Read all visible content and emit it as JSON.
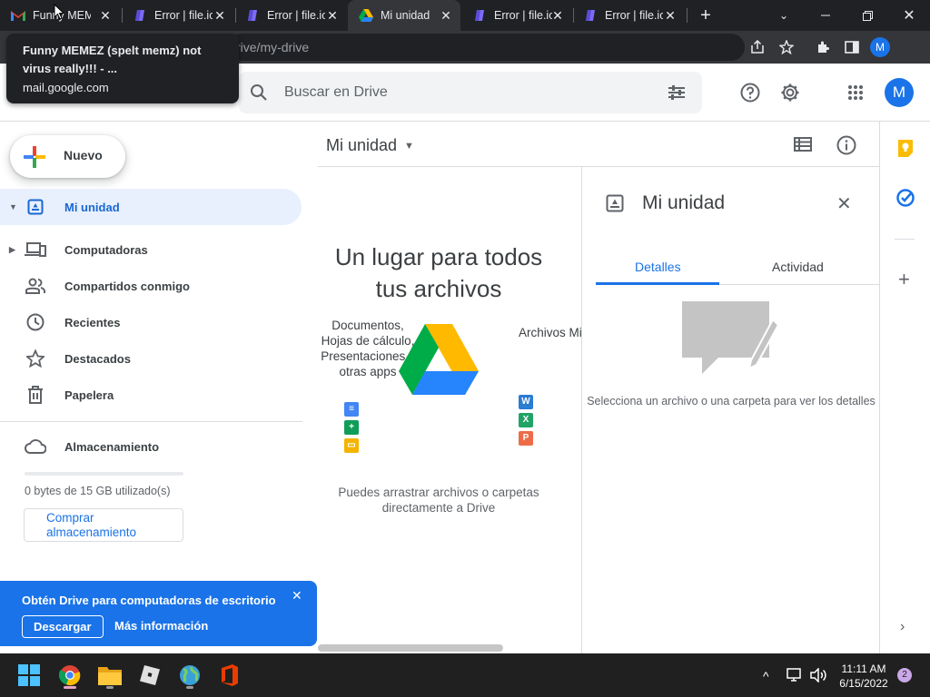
{
  "browser": {
    "tabs": [
      {
        "title": "Funny MEMEZ",
        "icon": "gmail-icon",
        "active": false
      },
      {
        "title": "Error | file.io",
        "icon": "fileio-icon",
        "active": false
      },
      {
        "title": "Error | file.io",
        "icon": "fileio-icon",
        "active": false
      },
      {
        "title": "Mi unidad",
        "icon": "drive-icon",
        "active": true
      },
      {
        "title": "Error | file.io",
        "icon": "fileio-icon",
        "active": false
      },
      {
        "title": "Error | file.io",
        "icon": "fileio-icon",
        "active": false
      }
    ],
    "address": "rive/my-drive",
    "profile_initial": "M"
  },
  "tooltip": {
    "title": "Funny MEMEZ (spelt memz) not virus really!!! - ...",
    "domain": "mail.google.com"
  },
  "header": {
    "search_placeholder": "Buscar en Drive",
    "avatar_initial": "M"
  },
  "sidebar": {
    "new_label": "Nuevo",
    "items": [
      {
        "label": "Mi unidad",
        "icon": "drive-icon"
      },
      {
        "label": "Computadoras",
        "icon": "computer-icon"
      },
      {
        "label": "Compartidos conmigo",
        "icon": "people-icon"
      },
      {
        "label": "Recientes",
        "icon": "clock-icon"
      },
      {
        "label": "Destacados",
        "icon": "star-icon"
      },
      {
        "label": "Papelera",
        "icon": "trash-icon"
      }
    ],
    "storage_label": "Almacenamiento",
    "storage_used_fraction": 0,
    "storage_text": "0 bytes de 15 GB utilizado(s)",
    "buy_label": "Comprar almacenamiento"
  },
  "promo": {
    "title": "Obtén Drive para computadoras de escritorio",
    "download_label": "Descargar",
    "more_label": "Más información"
  },
  "main": {
    "title": "Mi unidad",
    "empty_heading": "Un lugar para todos tus archivos",
    "left_caption": "Documentos, Hojas de cálculo, Presentaciones y otras apps",
    "right_caption": "Archivos Microso y de mu otros tip",
    "footer": "Puedes arrastrar archivos o carpetas directamente a Drive"
  },
  "details": {
    "title": "Mi unidad",
    "tab_details": "Detalles",
    "tab_activity": "Actividad",
    "hint": "Selecciona un archivo o una carpeta para ver los detalles"
  },
  "taskbar": {
    "time": "11:11 AM",
    "date": "6/15/2022",
    "notifications": "2"
  },
  "colors": {
    "accent": "#1a73e8",
    "active_bg": "#e8f0fe",
    "chrome_dark": "#202124"
  }
}
